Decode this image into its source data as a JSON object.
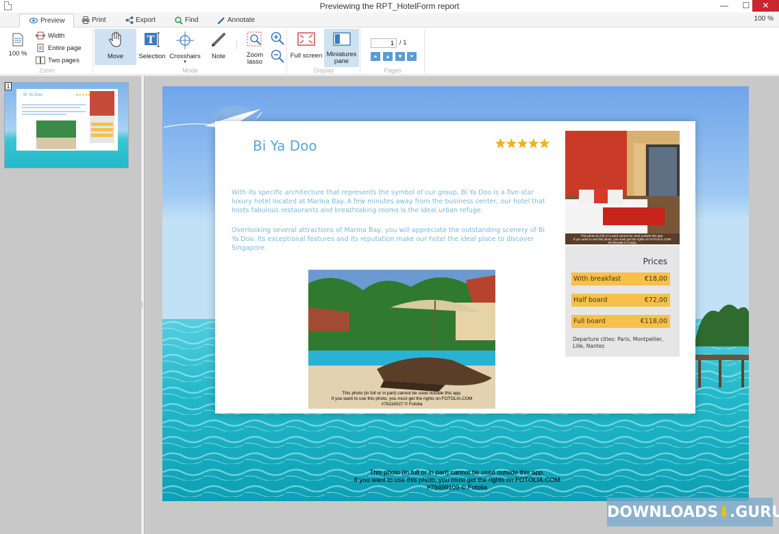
{
  "window": {
    "title": "Previewing the RPT_HotelForm report",
    "minimize": "—",
    "maximize": "☐",
    "close": "✕"
  },
  "tabs": [
    {
      "label": "Preview",
      "icon": "eye-icon"
    },
    {
      "label": "Print",
      "icon": "printer-icon"
    },
    {
      "label": "Export",
      "icon": "share-icon"
    },
    {
      "label": "Find",
      "icon": "magnifier-icon"
    },
    {
      "label": "Annotate",
      "icon": "pencil-icon"
    }
  ],
  "zoom_status": "100 %",
  "ribbon": {
    "zoom": {
      "label": "Zoom",
      "percent_button": "100 %",
      "width": "Width",
      "entire_page": "Entire page",
      "two_pages": "Two pages"
    },
    "mode": {
      "label": "Mode",
      "move": "Move",
      "selection": "Selection",
      "crosshairs": "Crosshairs",
      "note": "Note",
      "zoom_lasso_1": "Zoom",
      "zoom_lasso_2": "lasso"
    },
    "display": {
      "label": "Display",
      "full_screen": "Full screen",
      "miniatures_1": "Miniatures",
      "miniatures_2": "pane"
    },
    "pages": {
      "label": "Pages",
      "current_page": "1",
      "total": "/ 1"
    }
  },
  "miniature": {
    "page_number": "1",
    "thumb_title": "Bi Ya Doo"
  },
  "report": {
    "hotel_name": "Bi Ya Doo",
    "stars": "★★★★★",
    "rating": 5,
    "description_1": "With its specific architecture that represents the symbol of our group, Bi Ya Doo is a five-star luxury hotel located at Marina Bay. A few minutes away from the business center, our hotel that hosts fabulous restaurants and breathtaking rooms is the ideal urban refuge.",
    "description_2": "Overlooking several attractions of Marina Bay, you will appreciate the outstanding scenery of Bi Ya Doo. Its exceptional features and its reputation make our hotel the ideal place to discover Singapore.",
    "prices_title": "Prices",
    "prices": [
      {
        "name": "With breakfast",
        "value": "€18,00"
      },
      {
        "name": "Half board",
        "value": "€72,00"
      },
      {
        "name": "Full board",
        "value": "€118,00"
      }
    ],
    "departure": "Departure cities: Paris, Montpellier, Lille, Nantes",
    "pool_credit_1": "This photo (in full or in part) cannot be used outside this app.",
    "pool_credit_2": "If you want to use this photo, you must get the rights on FOTOLIA.COM",
    "pool_credit_3": "#78116027 © Fotolia",
    "page_credit_1": "This photo (in full or in part) cannot be used outside this app.",
    "page_credit_2": "If you want to use this photo, you must get the rights on FOTOLIA.COM",
    "page_credit_3": "#79499109 © Fotolia"
  },
  "watermark": "DOWNLOADS",
  "watermark_suffix": ".GURU",
  "colors": {
    "accent": "#58a8d6",
    "price_bar": "#f6c04a",
    "selected_button": "#cfe2f1",
    "close_button": "#c7282d"
  }
}
